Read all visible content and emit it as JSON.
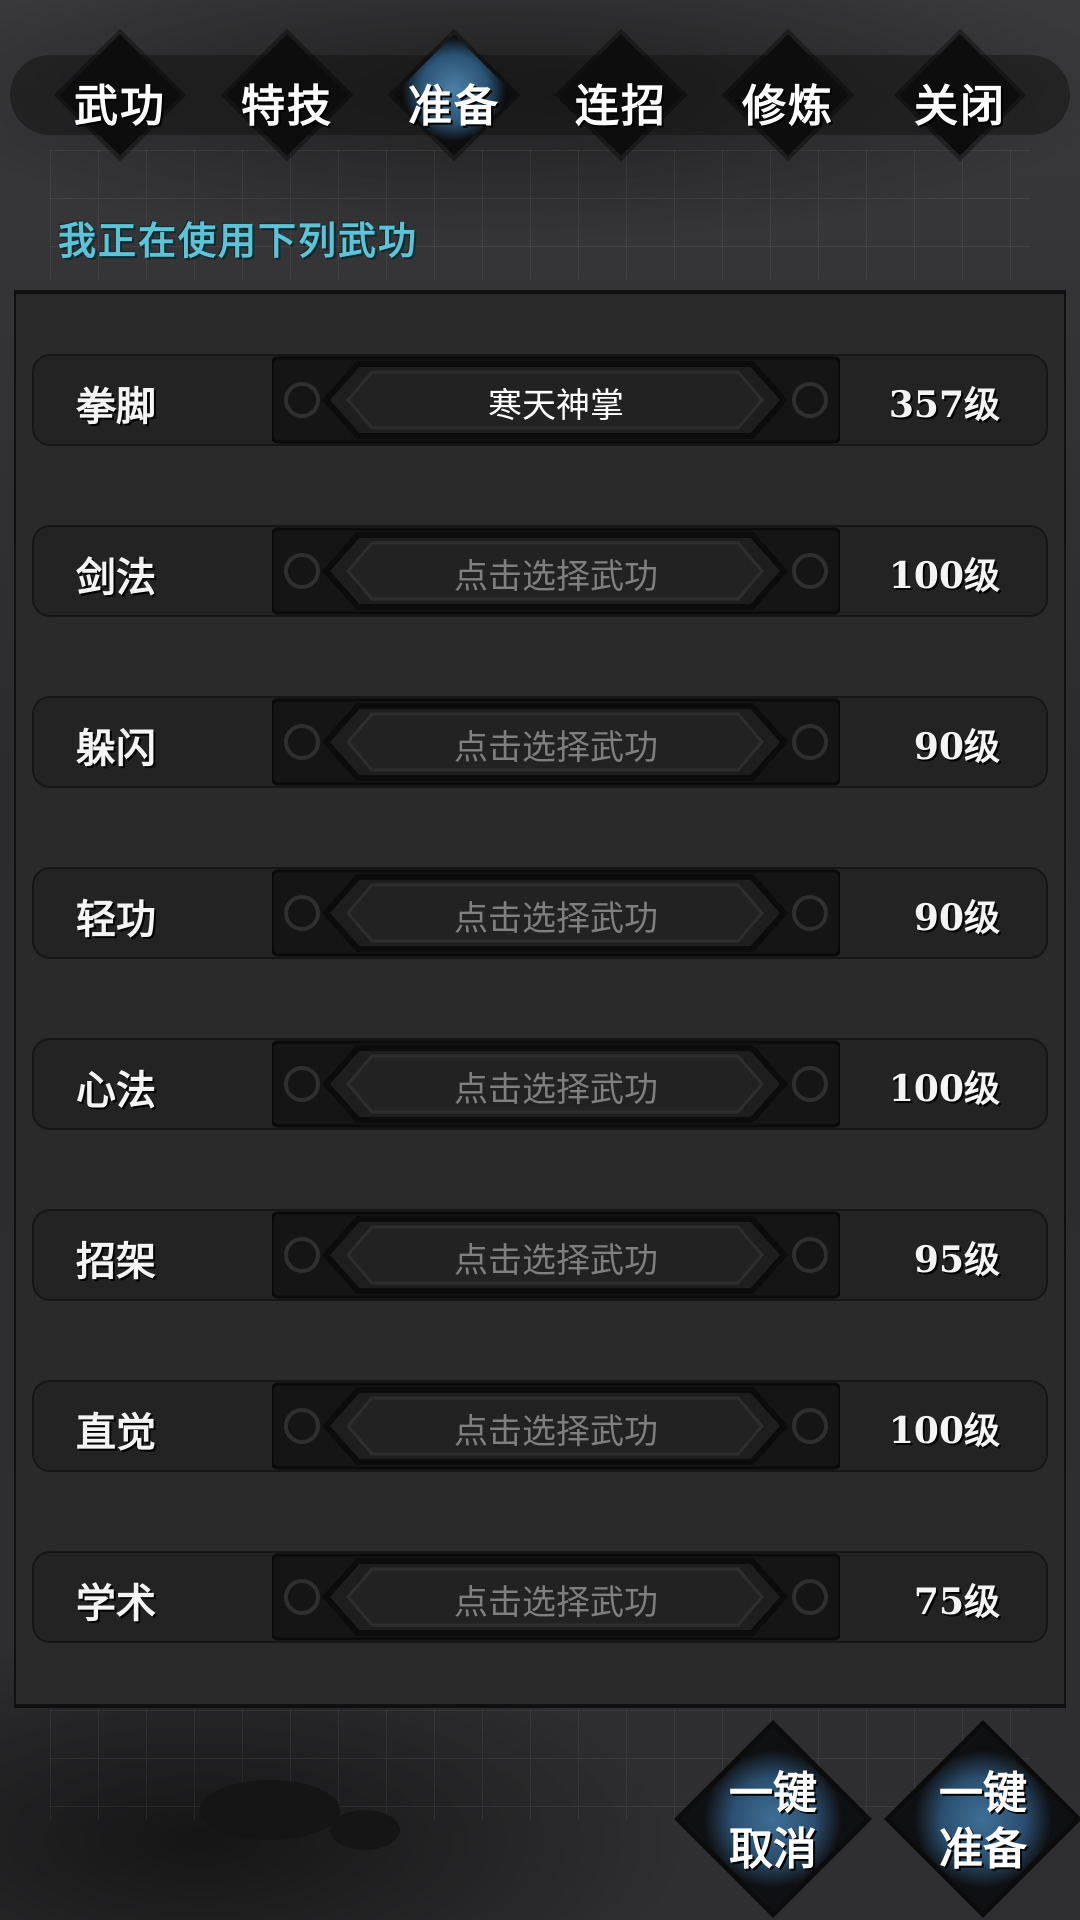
{
  "tabs": [
    {
      "label": "武功",
      "active": false
    },
    {
      "label": "特技",
      "active": false
    },
    {
      "label": "准备",
      "active": true
    },
    {
      "label": "连招",
      "active": false
    },
    {
      "label": "修炼",
      "active": false
    },
    {
      "label": "关闭",
      "active": false
    }
  ],
  "section_title": "我正在使用下列武功",
  "skills": [
    {
      "category": "拳脚",
      "selection": "寒天神掌",
      "level": "357级"
    },
    {
      "category": "剑法",
      "selection": "点击选择武功",
      "level": "100级"
    },
    {
      "category": "躲闪",
      "selection": "点击选择武功",
      "level": "90级"
    },
    {
      "category": "轻功",
      "selection": "点击选择武功",
      "level": "90级"
    },
    {
      "category": "心法",
      "selection": "点击选择武功",
      "level": "100级"
    },
    {
      "category": "招架",
      "selection": "点击选择武功",
      "level": "95级"
    },
    {
      "category": "直觉",
      "selection": "点击选择武功",
      "level": "100级"
    },
    {
      "category": "学术",
      "selection": "点击选择武功",
      "level": "75级"
    }
  ],
  "actions": {
    "cancel_line1": "一键",
    "cancel_line2": "取消",
    "prepare_line1": "一键",
    "prepare_line2": "准备"
  },
  "colors": {
    "accent": "#5fc3d6",
    "active_tab": "#2b5477",
    "placeholder_text": "#7f7f80"
  }
}
